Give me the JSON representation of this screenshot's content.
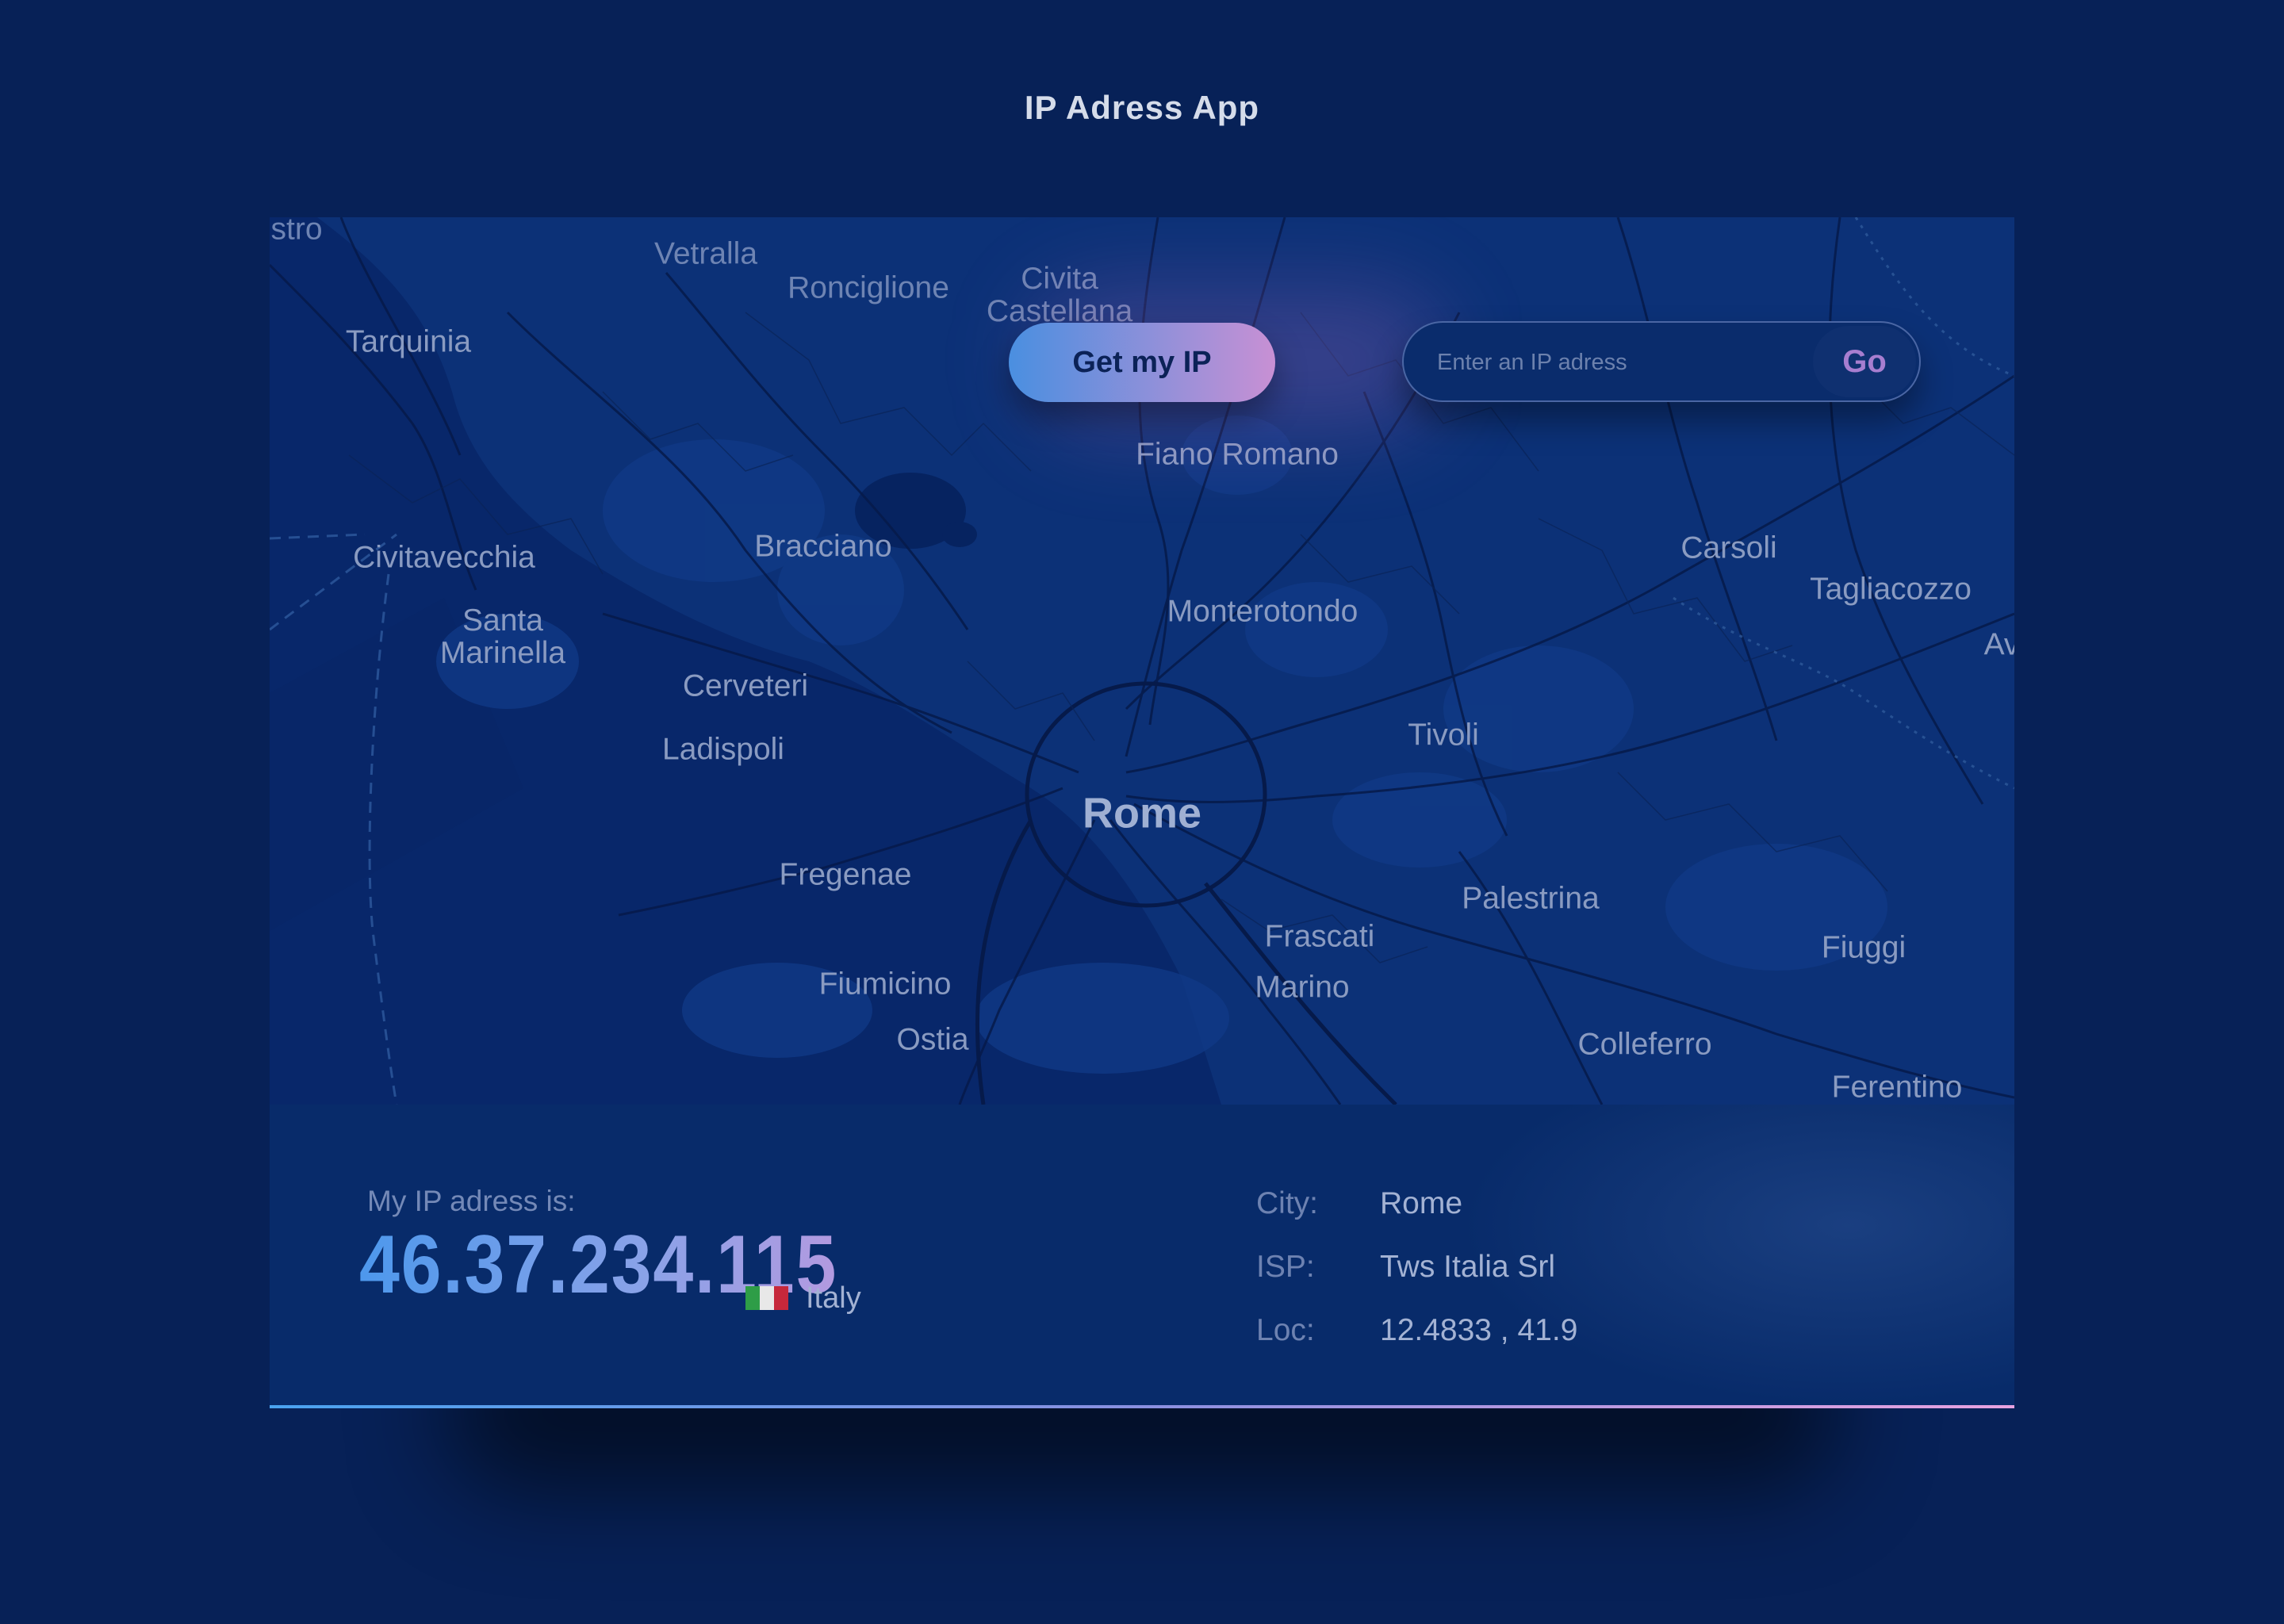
{
  "app": {
    "title": "IP Adress App"
  },
  "controls": {
    "get_ip_label": "Get my IP",
    "ip_placeholder": "Enter an IP adress",
    "ip_value": "",
    "go_label": "Go"
  },
  "map": {
    "labels": [
      "stro",
      "Vetralla",
      "Ronciglione",
      "Civita Castellana",
      "Tarquinia",
      "Fiano Romano",
      "Civitavecchia",
      "Bracciano",
      "Carsoli",
      "Tagliacozzo",
      "Monterotondo",
      "Santa Marinella",
      "Cerveteri",
      "Av",
      "Tivoli",
      "Ladispoli",
      "Rome",
      "Fregenae",
      "Palestrina",
      "Frascati",
      "Fiuggi",
      "Fiumicino",
      "Marino",
      "Ostia",
      "Colleferro",
      "Ferentino"
    ]
  },
  "info": {
    "caption": "My IP adress is:",
    "ip": "46.37.234.115",
    "country": "Italy",
    "country_flag_colors": [
      "#2e9d47",
      "#e8e8e8",
      "#c6283b"
    ],
    "details": [
      {
        "label": "City:",
        "value": "Rome"
      },
      {
        "label": "ISP:",
        "value": "Tws Italia Srl"
      },
      {
        "label": "Loc:",
        "value": "12.4833 , 41.9"
      }
    ]
  },
  "colors": {
    "background": "#072157",
    "map": "#0c3177",
    "sea": "#08276a",
    "accent_start": "#4a8fe0",
    "accent_end": "#c890d4"
  }
}
